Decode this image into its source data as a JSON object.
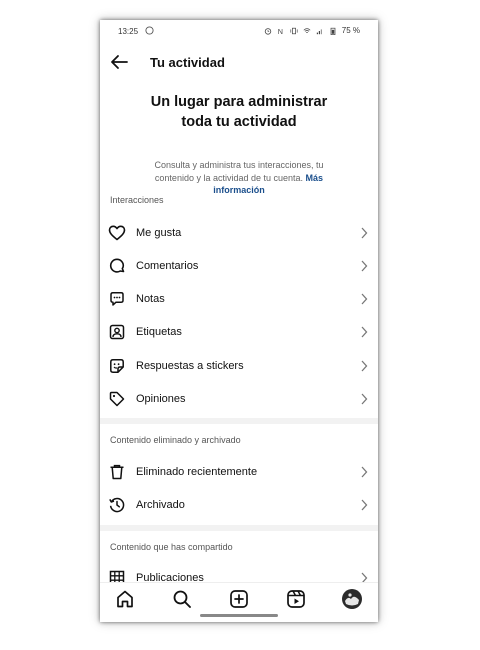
{
  "status": {
    "time": "13:25",
    "battery": "75 %"
  },
  "header": {
    "title": "Tu actividad"
  },
  "hero": {
    "title_line1": "Un lugar para administrar",
    "title_line2": "toda tu actividad",
    "description": "Consulta y administra tus interacciones, tu contenido y la actividad de tu cuenta.",
    "link": "Más información"
  },
  "sections": {
    "interacciones": "Interacciones",
    "eliminado": "Contenido eliminado y archivado",
    "compartido": "Contenido que has compartido"
  },
  "items": {
    "me_gusta": "Me gusta",
    "comentarios": "Comentarios",
    "notas": "Notas",
    "etiquetas": "Etiquetas",
    "respuestas_stickers": "Respuestas a stickers",
    "opiniones": "Opiniones",
    "eliminado_recientemente": "Eliminado recientemente",
    "archivado": "Archivado",
    "publicaciones": "Publicaciones"
  },
  "bottom_nav": [
    "home-icon",
    "search-icon",
    "create-icon",
    "reels-icon",
    "profile-avatar"
  ]
}
